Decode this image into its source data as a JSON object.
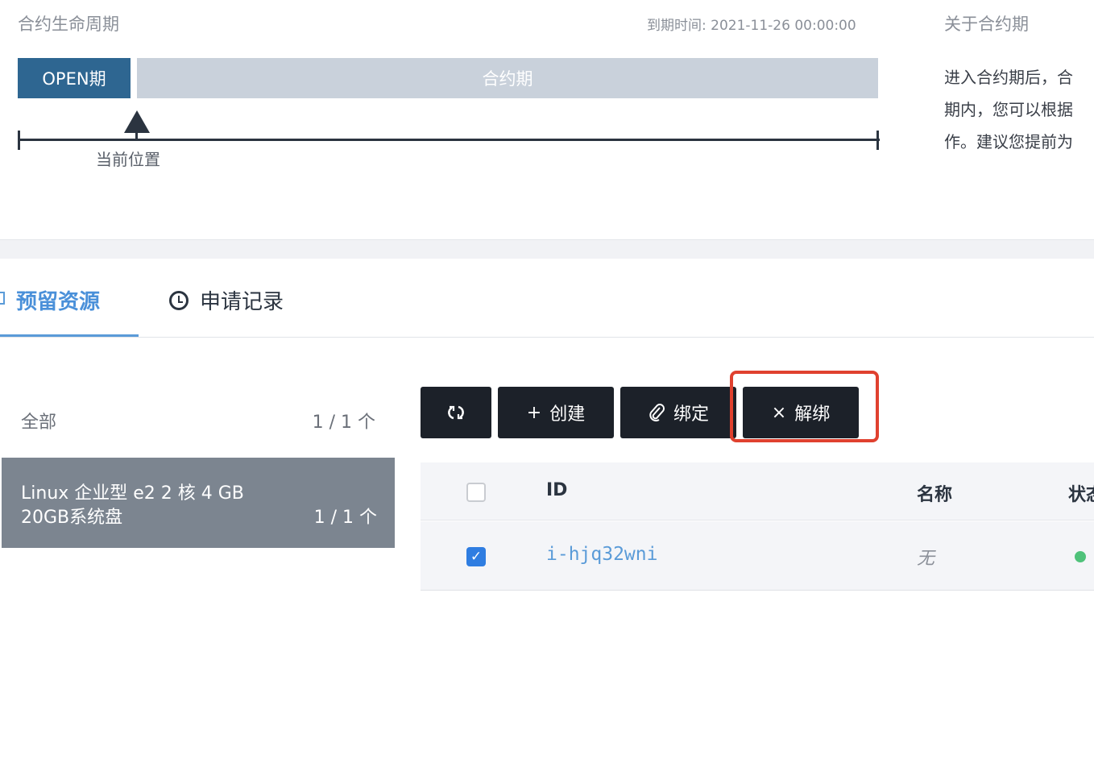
{
  "lifecycle": {
    "title": "合约生命周期",
    "expire_time": "到期时间: 2021-11-26 00:00:00",
    "phase_open": "OPEN期",
    "phase_contract": "合约期",
    "current_position": "当前位置"
  },
  "about": {
    "title": "关于合约期",
    "lines": [
      "进入合约期后，合",
      "期内，您可以根据",
      "作。建议您提前为"
    ]
  },
  "tabs": [
    {
      "label": "预留资源",
      "active": true
    },
    {
      "label": "申请记录",
      "active": false
    }
  ],
  "filters": {
    "all": {
      "label": "全部",
      "count": "1 / 1 个"
    },
    "item": {
      "line1": "Linux  企业型 e2  2 核  4 GB",
      "line2": "20GB系统盘",
      "count": "1 / 1 个"
    }
  },
  "toolbar": {
    "create_label": "创建",
    "bind_label": "绑定",
    "unbind_label": "解绑"
  },
  "table": {
    "columns": [
      "ID",
      "名称",
      "状态"
    ],
    "rows": [
      {
        "id": "i-hjq32wni",
        "name": "无",
        "checked": true,
        "status_color": "#4fc27a"
      }
    ]
  },
  "colors": {
    "open_phase": "#2e6691",
    "contract_phase": "#c9d1db",
    "active_tab": "#4a90d9",
    "highlight": "#e0412f",
    "button_bg": "#1c2129"
  }
}
